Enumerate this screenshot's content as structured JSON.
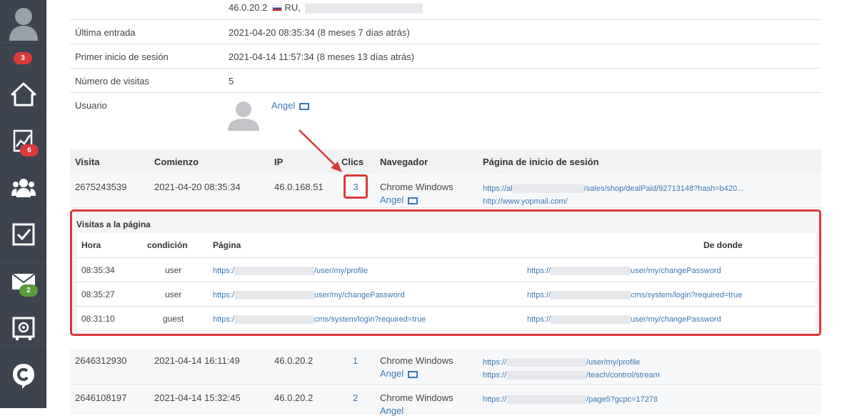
{
  "sidebar": {
    "avatar_badge": "3",
    "chart_badge": "6",
    "mail_badge": "2",
    "icons": [
      "user-avatar-icon",
      "home-icon",
      "chart-icon",
      "users-icon",
      "checkbox-icon",
      "mail-icon",
      "safe-icon",
      "chat-icon"
    ]
  },
  "info": {
    "ip_line": "46.0.20.2",
    "country": "RU,",
    "last_login_label": "Última entrada",
    "last_login_value": "2021-04-20 08:35:34 (8 meses 7 días atrás)",
    "first_login_label": "Primer inicio de sesión",
    "first_login_value": "2021-04-14 11:57:34 (8 meses 13 días atrás)",
    "visits_label": "Número de visitas",
    "visits_value": "5",
    "user_label": "Usuario",
    "user_name": "Angel"
  },
  "table": {
    "headers": [
      "Visita",
      "Comienzo",
      "IP",
      "Clics",
      "Navegador",
      "Página de inicio de sesión"
    ],
    "rows": [
      {
        "visit": "2675243539",
        "start": "2021-04-20 08:35:34",
        "ip": "46.0.168.51",
        "clicks": "3",
        "browser": "Chrome Windows",
        "user": "Angel",
        "page1_a": "https://al",
        "page1_b": "/sales/shop/dealPaid/92713148?hash=b420...",
        "page2": "http://www.yopmail.com/"
      },
      {
        "visit": "2646312930",
        "start": "2021-04-14 16:11:49",
        "ip": "46.0.20.2",
        "clicks": "1",
        "browser": "Chrome Windows",
        "user": "Angel",
        "page1_a": "https://",
        "page1_b": "/user/my/profile",
        "page2_a": "https://",
        "page2_b": "/teach/control/stream"
      },
      {
        "visit": "2646108197",
        "start": "2021-04-14 15:32:45",
        "ip": "46.0.20.2",
        "clicks": "2",
        "browser": "Chrome Windows",
        "user": "Angel",
        "page1_a": "https://",
        "page1_b": "/page5?gcpc=17278"
      }
    ]
  },
  "page_visits": {
    "title": "Visitas a la página",
    "headers": [
      "Hora",
      "condición",
      "Página",
      "De donde"
    ],
    "rows": [
      {
        "time": "08:35:34",
        "status": "user",
        "page_a": "https:/",
        "page_b": "/user/my/profile",
        "from_a": "https://",
        "from_b": "user/my/changePassword"
      },
      {
        "time": "08:35:27",
        "status": "user",
        "page_a": "https:/",
        "page_b": "user/my/changePassword",
        "from_a": "https://",
        "from_b": "cms/system/login?required=true"
      },
      {
        "time": "08:31:10",
        "status": "guest",
        "page_a": "https:/",
        "page_b": "cms/system/login?required=true",
        "from_a": "https://",
        "from_b": "user/my/changePassword"
      }
    ]
  },
  "colors": {
    "sidebar": "#3d4450",
    "accent_red": "#d93a3a",
    "link": "#3a78b5",
    "badge_green": "#5a9b3c"
  }
}
